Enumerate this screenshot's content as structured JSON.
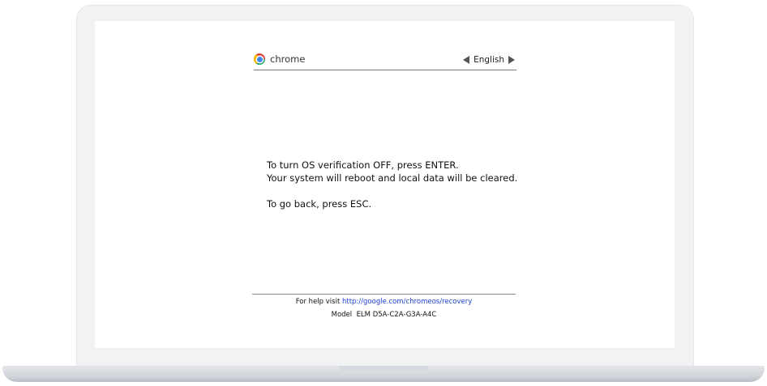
{
  "header": {
    "brand": "chrome",
    "language": "English"
  },
  "message": {
    "line1": "To turn OS verification OFF, press ENTER.",
    "line2": "Your system will reboot and local data will be cleared.",
    "line3": "To go back, press ESC."
  },
  "footer": {
    "help_prefix": "For help visit",
    "help_link": "http://google.com/chromeos/recovery",
    "model_label": "Model",
    "model_value": "ELM D5A-C2A-G3A-A4C"
  }
}
